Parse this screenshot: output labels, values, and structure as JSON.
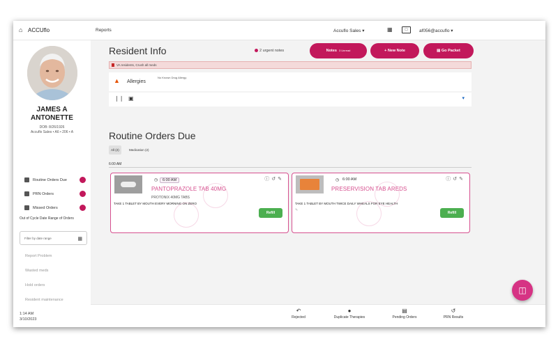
{
  "topbar": {
    "brand": "ACCUflo",
    "reports": "Reports",
    "facility": "Accuflo Sales",
    "user": "af056@accuflo"
  },
  "resident": {
    "name_line1": "JAMES A",
    "name_line2": "ANTONETTE",
    "dob": "DOB: 8/26/1926",
    "location": "Accuflo Sales • A6 • 206 • A"
  },
  "sidebar": {
    "items": [
      {
        "label": "Routine Orders Due"
      },
      {
        "label": "PRN Orders"
      },
      {
        "label": "Missed Orders"
      }
    ],
    "out_of_cycle_label": "Out of Cycle Date Range of Orders",
    "date_filter_placeholder": "Filter by date range",
    "links": [
      "Report Problem",
      "Wasted meds",
      "Hold orders",
      "Resident maintenance"
    ],
    "time": "1:14 AM",
    "date": "3/10/2023"
  },
  "header": {
    "title": "Resident Info",
    "urgent_notes": "2 urgent notes",
    "notes_button": "Notes",
    "notes_badge": "3 Unread",
    "new_note_button": "+ New Note",
    "go_packet_button": "Go Packet"
  },
  "alert_text": "VA residents, Crush all meds",
  "allergies": {
    "label": "Allergies",
    "value": "No Known Drug Allergy"
  },
  "orders": {
    "title": "Routine Orders Due",
    "tabs": [
      "All (2)",
      "Medication (2)"
    ],
    "time_header": "6:00 AM",
    "cards": [
      {
        "time": "6:00 AM",
        "drug": "PANTOPRAZOLE TAB 40MG",
        "generic": "PROTONIX 40MG TABS",
        "sig": "TAKE 1 TABLET BY MOUTH EVERY MORNING ON ZERO",
        "action": "Refill"
      },
      {
        "time": "6:00 AM",
        "drug": "PRESERVISION TAB AREDS",
        "generic": "",
        "sig": "TAKE 1 TABLET BY MOUTH TWICE DAILY WHEALS FOR EYE HEALTH",
        "action": "Refill"
      }
    ]
  },
  "bottombar": {
    "items": [
      "Rejected",
      "Duplicate Therapies",
      "Pending Orders",
      "PRN Results"
    ]
  },
  "colors": {
    "accent": "#c2185b",
    "card_border": "#d64f8e",
    "refill_green": "#4caf50",
    "fab": "#d63384"
  }
}
